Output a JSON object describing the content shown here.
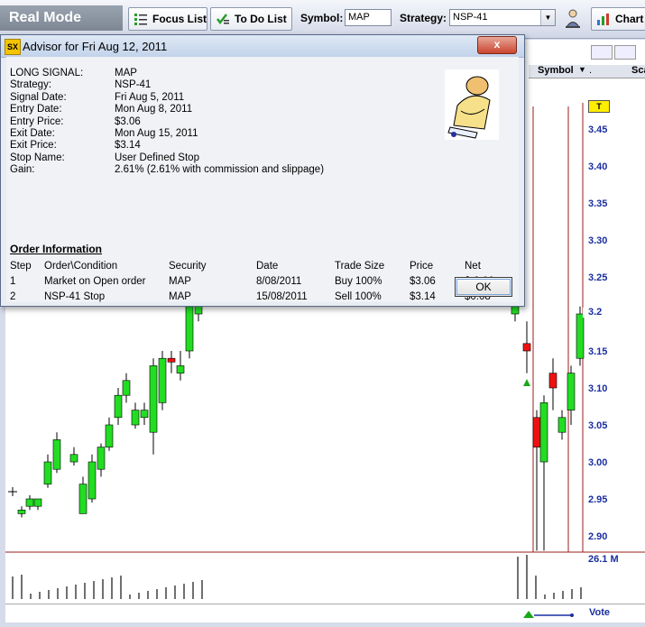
{
  "toolbar": {
    "mode": "Real Mode",
    "focus_list": "Focus List",
    "todo_list": "To Do List",
    "symbol_label": "Symbol:",
    "symbol_value": "MAP",
    "strategy_label": "Strategy:",
    "strategy_value": "NSP-41",
    "chart_label": "Chart"
  },
  "chart_header": {
    "symbol_col": "Symbol",
    "scan_col": "Sca"
  },
  "dialog": {
    "title": "Advisor for Fri Aug 12, 2011",
    "close_label": "x",
    "fields": [
      {
        "label": "LONG SIGNAL:",
        "value": "MAP"
      },
      {
        "label": "Strategy:",
        "value": "NSP-41"
      },
      {
        "label": "Signal Date:",
        "value": "Fri Aug 5, 2011"
      },
      {
        "label": "Entry Date:",
        "value": "Mon Aug 8, 2011"
      },
      {
        "label": "Entry Price:",
        "value": "$3.06"
      },
      {
        "label": "Exit Date:",
        "value": "Mon Aug 15, 2011"
      },
      {
        "label": "Exit Price:",
        "value": "$3.14"
      },
      {
        "label": "Stop Name:",
        "value": "User Defined Stop"
      },
      {
        "label": "Gain:",
        "value": "2.61% (2.61% with commission and slippage)"
      }
    ],
    "order_heading": "Order Information",
    "order_columns": [
      "Step",
      "Order\\Condition",
      "Security",
      "Date",
      "Trade Size",
      "Price",
      "Net"
    ],
    "orders": [
      [
        "1",
        "Market on Open order",
        "MAP",
        "8/08/2011",
        "Buy 100%",
        "$3.06",
        "$-3.06"
      ],
      [
        "2",
        "NSP-41 Stop",
        "MAP",
        "15/08/2011",
        "Sell 100%",
        "$3.14",
        "$0.08"
      ]
    ],
    "ok_label": "OK"
  },
  "chart": {
    "y_ticks": [
      "3.45",
      "3.40",
      "3.35",
      "3.30",
      "3.25",
      "3.20",
      "3.15",
      "3.10",
      "3.05",
      "3.00",
      "2.95",
      "2.90"
    ],
    "y_values": [
      3.45,
      3.4,
      3.35,
      3.3,
      3.25,
      3.2,
      3.15,
      3.1,
      3.05,
      3.0,
      2.95,
      2.9
    ],
    "price_marker": "3.2",
    "tag_marker": "T",
    "volume_label": "26.1 M",
    "vote_label": "Vote",
    "colors": {
      "up": "#22dd22",
      "down": "#ee1111",
      "axis": "#1a2ea0",
      "grid": "#9b1c1c"
    }
  }
}
